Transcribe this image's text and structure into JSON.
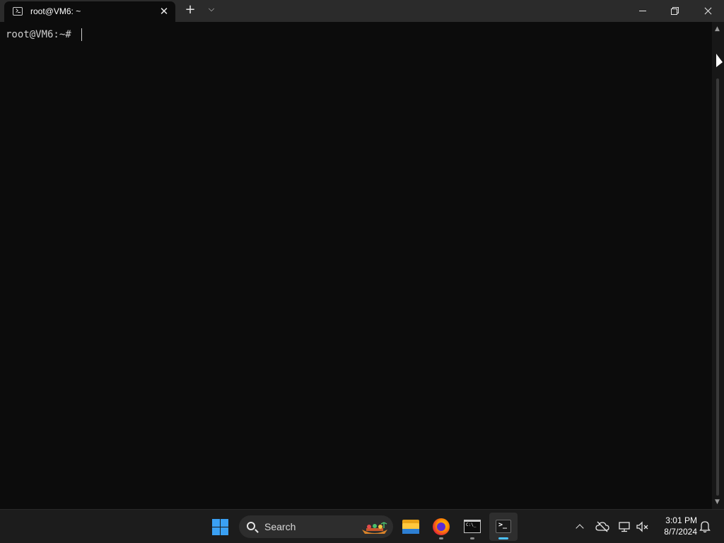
{
  "window": {
    "tab_title": "root@VM6: ~",
    "tab_icon": "terminal-tab-icon",
    "new_tab_icon": "plus-icon",
    "dropdown_icon": "chevron-down-icon",
    "controls": [
      "minimize-icon",
      "restore-icon",
      "close-icon"
    ]
  },
  "terminal": {
    "prompt": "root@VM6:~#",
    "text_color": "#cccccc",
    "background": "#0c0c0c"
  },
  "taskbar": {
    "search_label": "Search",
    "apps": [
      {
        "name": "File Explorer",
        "icon": "folder-icon"
      },
      {
        "name": "Firefox",
        "icon": "firefox-icon"
      },
      {
        "name": "Command Prompt",
        "icon": "cmd-icon"
      },
      {
        "name": "Terminal",
        "icon": "terminal-icon",
        "active": true
      }
    ],
    "tray": {
      "icons": [
        "chevron-up-icon",
        "cloud-off-icon",
        "network-icon",
        "volume-muted-icon"
      ],
      "time": "3:01 PM",
      "date": "8/7/2024"
    },
    "accent": "#4cc2ff"
  }
}
